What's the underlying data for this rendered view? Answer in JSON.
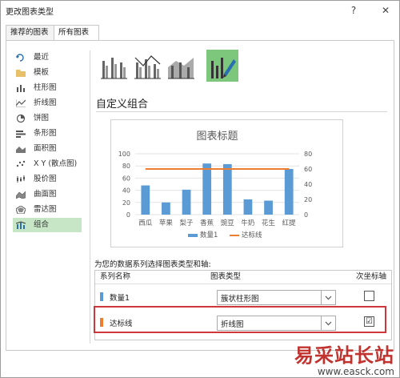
{
  "window": {
    "title": "更改图表类型",
    "help": "?",
    "close": "✕"
  },
  "tabs": [
    {
      "label": "推荐的图表"
    },
    {
      "label": "所有图表"
    }
  ],
  "sidebar": {
    "items": [
      {
        "label": "最近",
        "icon": "recent-icon"
      },
      {
        "label": "模板",
        "icon": "folder-icon"
      },
      {
        "label": "柱形图",
        "icon": "column-chart-icon"
      },
      {
        "label": "折线图",
        "icon": "line-chart-icon"
      },
      {
        "label": "饼图",
        "icon": "pie-chart-icon"
      },
      {
        "label": "条形图",
        "icon": "bar-chart-icon"
      },
      {
        "label": "面积图",
        "icon": "area-chart-icon"
      },
      {
        "label": "X Y (散点图)",
        "icon": "scatter-chart-icon"
      },
      {
        "label": "股价图",
        "icon": "stock-chart-icon"
      },
      {
        "label": "曲面图",
        "icon": "surface-chart-icon"
      },
      {
        "label": "雷达图",
        "icon": "radar-chart-icon"
      },
      {
        "label": "组合",
        "icon": "combo-chart-icon"
      }
    ],
    "selected": "组合"
  },
  "main": {
    "section_title": "自定义组合",
    "series_prompt": "为您的数据系列选择图表类型和轴:",
    "grid": {
      "headers": [
        "系列名称",
        "图表类型",
        "次坐标轴"
      ],
      "rows": [
        {
          "name": "数量1",
          "chart_type": "簇状柱形图",
          "secondary_axis": "",
          "color": "#5b9bd5"
        },
        {
          "name": "达标线",
          "chart_type": "折线图",
          "secondary_axis": "☑",
          "color": "#ed7d31"
        }
      ]
    }
  },
  "chart_data": {
    "type": "bar",
    "title": "图表标题",
    "categories": [
      "西瓜",
      "苹果",
      "梨子",
      "香蕉",
      "豌豆",
      "牛奶",
      "花生",
      "红提"
    ],
    "series": [
      {
        "name": "数量1",
        "type": "bar",
        "axis": "primary",
        "color": "#5b9bd5",
        "values": [
          48,
          20,
          41,
          84,
          83,
          25,
          23,
          75
        ]
      },
      {
        "name": "达标线",
        "type": "line",
        "axis": "secondary",
        "color": "#ed7d31",
        "values": [
          60,
          60,
          60,
          60,
          60,
          60,
          60,
          60
        ]
      }
    ],
    "ylim": [
      0,
      100
    ],
    "y_ticks": [
      "0",
      "20",
      "40",
      "60",
      "80",
      "100"
    ],
    "y2lim": [
      0,
      80
    ],
    "y2_ticks": [
      "0",
      "20",
      "40",
      "60",
      "80"
    ],
    "grid": true,
    "legend": "bottom"
  },
  "watermark": {
    "text": "易采站长站",
    "url": "www.easck.com"
  }
}
